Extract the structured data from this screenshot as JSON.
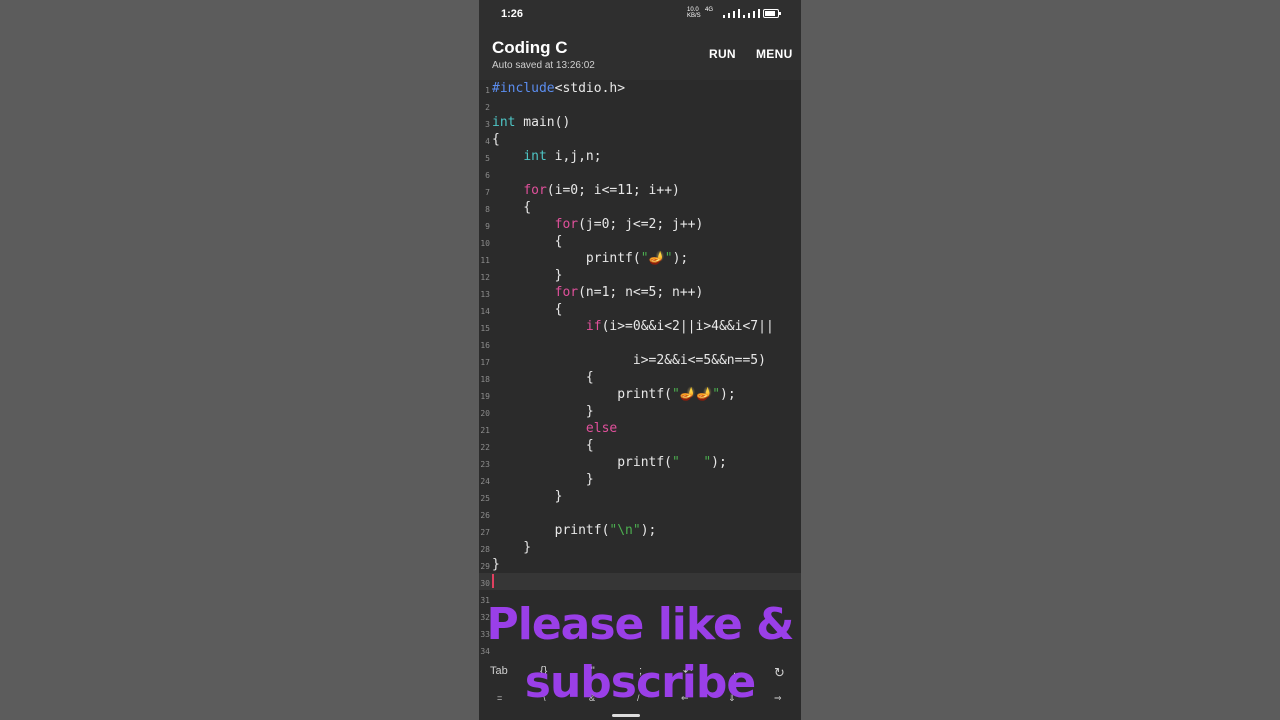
{
  "status_bar": {
    "time": "1:26",
    "net_speed": "10.0",
    "net_unit": "KB/S",
    "network_type": "4G"
  },
  "app_bar": {
    "title": "Coding C",
    "subtitle": "Auto saved at 13:26:02",
    "run_label": "RUN",
    "menu_label": "MENU"
  },
  "editor": {
    "line_numbers": [
      "1",
      "2",
      "3",
      "4",
      "5",
      "6",
      "7",
      "8",
      "9",
      "10",
      "11",
      "12",
      "13",
      "14",
      "15",
      "16",
      "17",
      "18",
      "19",
      "20",
      "21",
      "22",
      "23",
      "24",
      "25",
      "26",
      "27",
      "28",
      "29",
      "30",
      "31",
      "32",
      "33",
      "34"
    ],
    "lines": {
      "l1a": "#include",
      "l1b": "<stdio.h>",
      "l3a": "int",
      "l3b": " main()",
      "l4": "{",
      "l5a": "    ",
      "l5b": "int",
      "l5c": " i,j,n;",
      "l7a": "    ",
      "l7b": "for",
      "l7c": "(i=0; i<=11; i++)",
      "l8": "    {",
      "l9a": "        ",
      "l9b": "for",
      "l9c": "(j=0; j<=2; j++)",
      "l10": "        {",
      "l11a": "            printf(",
      "l11b": "\"",
      "l11c": "🪔",
      "l11d": "\"",
      "l11e": ");",
      "l12": "        }",
      "l13a": "        ",
      "l13b": "for",
      "l13c": "(n=1; n<=5; n++)",
      "l14": "        {",
      "l15a": "            ",
      "l15b": "if",
      "l15c": "(i>=0&&i<2||i>4&&i<7||",
      "l17": "                  i>=2&&i<=5&&n==5)",
      "l18": "            {",
      "l19a": "                printf(",
      "l19b": "\"",
      "l19c": "🪔🪔",
      "l19d": "\"",
      "l19e": ");",
      "l20": "            }",
      "l21a": "            ",
      "l21b": "else",
      "l22": "            {",
      "l23a": "                printf(",
      "l23b": "\"   \"",
      "l23c": ");",
      "l24": "            }",
      "l25": "        }",
      "l27a": "        printf(",
      "l27b": "\"\\n\"",
      "l27c": ");",
      "l28": "    }",
      "l29": "}"
    }
  },
  "keyboard_bar": {
    "row1": [
      "Tab",
      "{}",
      "\"\"",
      ";",
      "↶",
      ",",
      "↻"
    ],
    "row2": [
      "=",
      "\\",
      "&",
      "/",
      "⇐",
      "⇓",
      "⇒"
    ]
  },
  "overlay": {
    "line1": "Please like &",
    "line2": "subscribe"
  },
  "colors": {
    "keyword": "#e0509b",
    "type": "#4ec5c5",
    "preprocessor": "#5b8def",
    "string": "#4caf50",
    "overlay_text": "#9a3fe8"
  }
}
